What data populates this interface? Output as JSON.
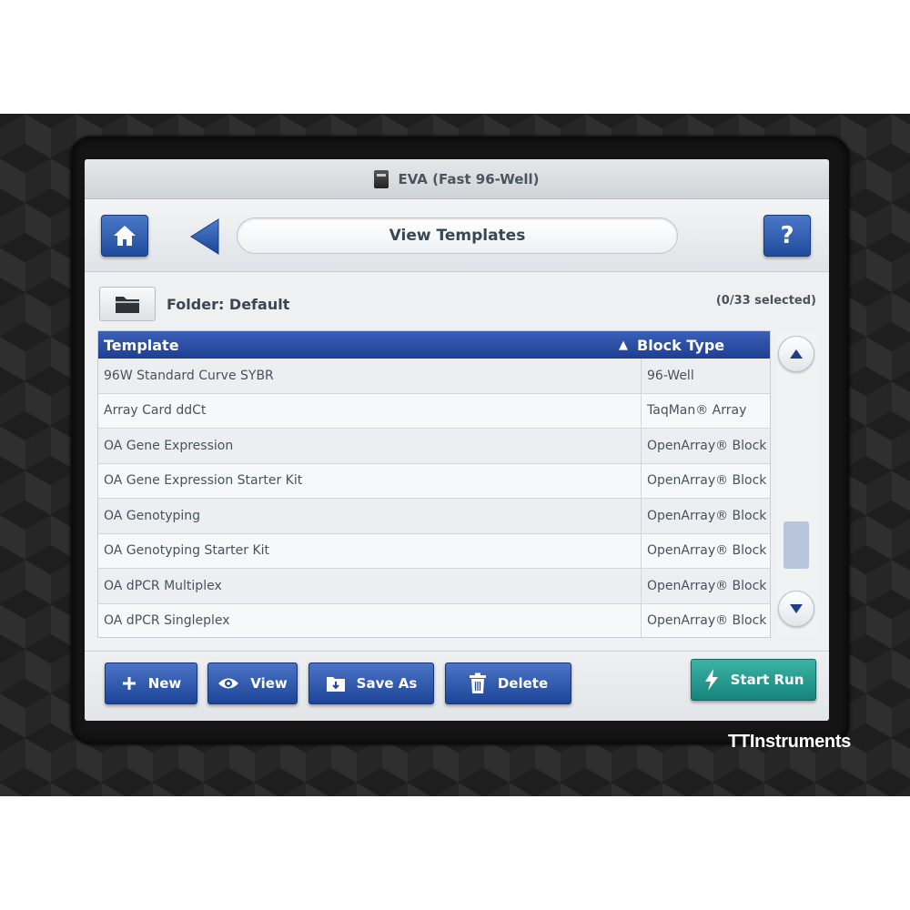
{
  "window": {
    "title": "EVA (Fast 96-Well)"
  },
  "nav": {
    "page_title": "View Templates",
    "help_label": "?"
  },
  "folder": {
    "label": "Folder:  Default",
    "selection_status": "(0/33 selected)"
  },
  "table": {
    "columns": {
      "template": "Template",
      "block_type": "Block Type"
    },
    "sort": {
      "column": "Block Type",
      "direction": "ascending"
    },
    "rows": [
      {
        "template": "96W Standard Curve SYBR",
        "block_type": "96-Well"
      },
      {
        "template": "Array Card ddCt",
        "block_type": "TaqMan® Array"
      },
      {
        "template": "OA Gene Expression",
        "block_type": "OpenArray® Block"
      },
      {
        "template": "OA Gene Expression Starter Kit",
        "block_type": "OpenArray® Block"
      },
      {
        "template": "OA Genotyping",
        "block_type": "OpenArray® Block"
      },
      {
        "template": "OA Genotyping Starter Kit",
        "block_type": "OpenArray® Block"
      },
      {
        "template": "OA dPCR Multiplex",
        "block_type": "OpenArray® Block"
      },
      {
        "template": "OA dPCR Singleplex",
        "block_type": "OpenArray® Block"
      }
    ]
  },
  "toolbar": {
    "new_label": "New",
    "view_label": "View",
    "save_as_label": "Save As",
    "delete_label": "Delete",
    "start_run_label": "Start Run"
  },
  "watermark": "TTInstruments",
  "colors": {
    "primary_button": "#1f4c9c",
    "header_blue": "#2a4ea5",
    "start_run_teal": "#16847a"
  },
  "icons": {
    "home": "home-icon",
    "back": "back-arrow-icon",
    "help": "help-icon",
    "folder": "folder-icon",
    "sort": "sort-ascending-icon",
    "new": "plus-icon",
    "view": "eye-icon",
    "save_as": "save-folder-icon",
    "delete": "trash-icon",
    "start_run": "lightning-icon"
  }
}
